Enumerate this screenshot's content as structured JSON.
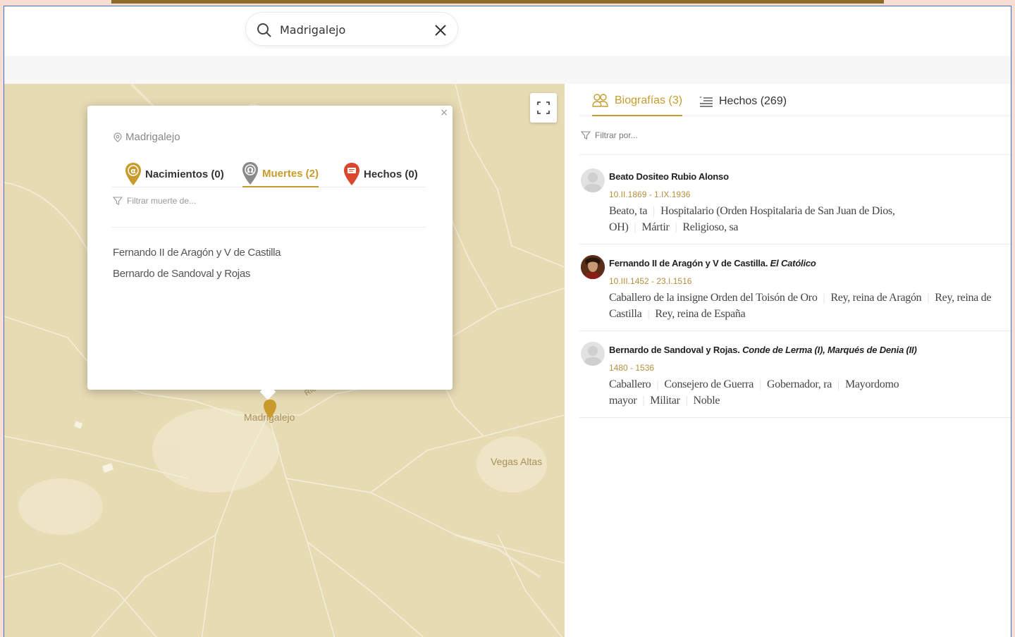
{
  "search": {
    "value": "Madrigalejo"
  },
  "map": {
    "labels": {
      "town": "Madrigalejo",
      "village": "Vegas Altas",
      "river": "Río"
    },
    "popup": {
      "place": "Madrigalejo",
      "tabs": [
        {
          "label": "Nacimientos (0)"
        },
        {
          "label": "Muertes (2)"
        },
        {
          "label": "Hechos (0)"
        }
      ],
      "filter_placeholder": "Filtrar muerte de...",
      "results": [
        "Fernando II de Aragón y V de Castilla",
        "Bernardo de Sandoval y Rojas"
      ]
    }
  },
  "panel": {
    "tabs": [
      {
        "label": "Biografías (3)"
      },
      {
        "label": "Hechos (269)"
      }
    ],
    "filter_placeholder": "Filtrar por...",
    "biographies": [
      {
        "name": "Beato Dositeo Rubio Alonso",
        "title": "",
        "dates": "10.II.1869 - 1.IX.1936",
        "roles": [
          "Beato, ta",
          "Hospitalario (Orden Hospitalaria de San Juan de Dios, OH)",
          "Mártir",
          "Religioso, sa"
        ]
      },
      {
        "name": "Fernando II de Aragón y V de Castilla.",
        "title": "El Católico",
        "dates": "10.III.1452 - 23.I.1516",
        "roles": [
          "Caballero de la insigne Orden del Toisón de Oro",
          "Rey, reina de Aragón",
          "Rey, reina de Castilla",
          "Rey, reina de España"
        ]
      },
      {
        "name": "Bernardo de Sandoval y Rojas.",
        "title": "Conde de Lerma (I), Marqués de Denia (II)",
        "dates": "1480 - 1536",
        "roles": [
          "Caballero",
          "Consejero de Guerra",
          "Gobernador, ra",
          "Mayordomo mayor",
          "Militar",
          "Noble"
        ]
      }
    ]
  },
  "colors": {
    "accent": "#c89b2c",
    "map_bg": "#e7dbb4",
    "birth_marker": "#c89b2c",
    "death_marker": "#8a8a8a",
    "event_marker": "#d9462b"
  }
}
